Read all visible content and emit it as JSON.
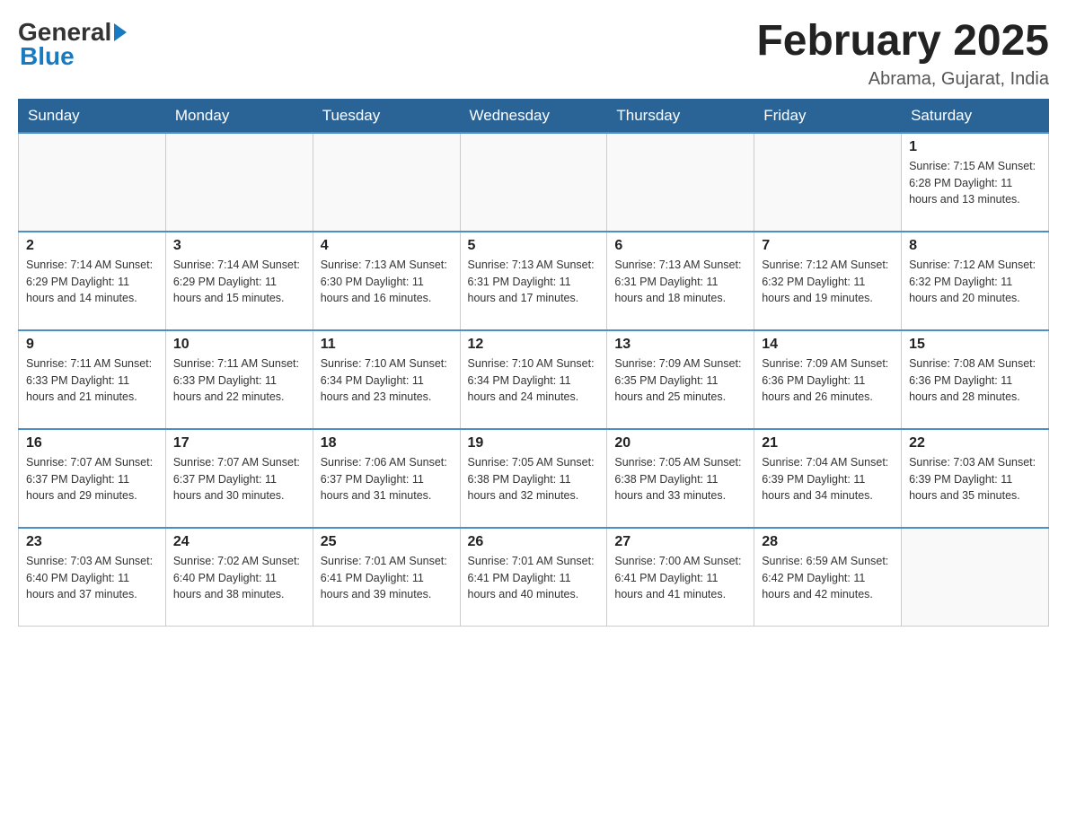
{
  "header": {
    "logo_general": "General",
    "logo_blue": "Blue",
    "month_title": "February 2025",
    "location": "Abrama, Gujarat, India"
  },
  "weekdays": [
    "Sunday",
    "Monday",
    "Tuesday",
    "Wednesday",
    "Thursday",
    "Friday",
    "Saturday"
  ],
  "weeks": [
    [
      {
        "day": "",
        "info": ""
      },
      {
        "day": "",
        "info": ""
      },
      {
        "day": "",
        "info": ""
      },
      {
        "day": "",
        "info": ""
      },
      {
        "day": "",
        "info": ""
      },
      {
        "day": "",
        "info": ""
      },
      {
        "day": "1",
        "info": "Sunrise: 7:15 AM\nSunset: 6:28 PM\nDaylight: 11 hours\nand 13 minutes."
      }
    ],
    [
      {
        "day": "2",
        "info": "Sunrise: 7:14 AM\nSunset: 6:29 PM\nDaylight: 11 hours\nand 14 minutes."
      },
      {
        "day": "3",
        "info": "Sunrise: 7:14 AM\nSunset: 6:29 PM\nDaylight: 11 hours\nand 15 minutes."
      },
      {
        "day": "4",
        "info": "Sunrise: 7:13 AM\nSunset: 6:30 PM\nDaylight: 11 hours\nand 16 minutes."
      },
      {
        "day": "5",
        "info": "Sunrise: 7:13 AM\nSunset: 6:31 PM\nDaylight: 11 hours\nand 17 minutes."
      },
      {
        "day": "6",
        "info": "Sunrise: 7:13 AM\nSunset: 6:31 PM\nDaylight: 11 hours\nand 18 minutes."
      },
      {
        "day": "7",
        "info": "Sunrise: 7:12 AM\nSunset: 6:32 PM\nDaylight: 11 hours\nand 19 minutes."
      },
      {
        "day": "8",
        "info": "Sunrise: 7:12 AM\nSunset: 6:32 PM\nDaylight: 11 hours\nand 20 minutes."
      }
    ],
    [
      {
        "day": "9",
        "info": "Sunrise: 7:11 AM\nSunset: 6:33 PM\nDaylight: 11 hours\nand 21 minutes."
      },
      {
        "day": "10",
        "info": "Sunrise: 7:11 AM\nSunset: 6:33 PM\nDaylight: 11 hours\nand 22 minutes."
      },
      {
        "day": "11",
        "info": "Sunrise: 7:10 AM\nSunset: 6:34 PM\nDaylight: 11 hours\nand 23 minutes."
      },
      {
        "day": "12",
        "info": "Sunrise: 7:10 AM\nSunset: 6:34 PM\nDaylight: 11 hours\nand 24 minutes."
      },
      {
        "day": "13",
        "info": "Sunrise: 7:09 AM\nSunset: 6:35 PM\nDaylight: 11 hours\nand 25 minutes."
      },
      {
        "day": "14",
        "info": "Sunrise: 7:09 AM\nSunset: 6:36 PM\nDaylight: 11 hours\nand 26 minutes."
      },
      {
        "day": "15",
        "info": "Sunrise: 7:08 AM\nSunset: 6:36 PM\nDaylight: 11 hours\nand 28 minutes."
      }
    ],
    [
      {
        "day": "16",
        "info": "Sunrise: 7:07 AM\nSunset: 6:37 PM\nDaylight: 11 hours\nand 29 minutes."
      },
      {
        "day": "17",
        "info": "Sunrise: 7:07 AM\nSunset: 6:37 PM\nDaylight: 11 hours\nand 30 minutes."
      },
      {
        "day": "18",
        "info": "Sunrise: 7:06 AM\nSunset: 6:37 PM\nDaylight: 11 hours\nand 31 minutes."
      },
      {
        "day": "19",
        "info": "Sunrise: 7:05 AM\nSunset: 6:38 PM\nDaylight: 11 hours\nand 32 minutes."
      },
      {
        "day": "20",
        "info": "Sunrise: 7:05 AM\nSunset: 6:38 PM\nDaylight: 11 hours\nand 33 minutes."
      },
      {
        "day": "21",
        "info": "Sunrise: 7:04 AM\nSunset: 6:39 PM\nDaylight: 11 hours\nand 34 minutes."
      },
      {
        "day": "22",
        "info": "Sunrise: 7:03 AM\nSunset: 6:39 PM\nDaylight: 11 hours\nand 35 minutes."
      }
    ],
    [
      {
        "day": "23",
        "info": "Sunrise: 7:03 AM\nSunset: 6:40 PM\nDaylight: 11 hours\nand 37 minutes."
      },
      {
        "day": "24",
        "info": "Sunrise: 7:02 AM\nSunset: 6:40 PM\nDaylight: 11 hours\nand 38 minutes."
      },
      {
        "day": "25",
        "info": "Sunrise: 7:01 AM\nSunset: 6:41 PM\nDaylight: 11 hours\nand 39 minutes."
      },
      {
        "day": "26",
        "info": "Sunrise: 7:01 AM\nSunset: 6:41 PM\nDaylight: 11 hours\nand 40 minutes."
      },
      {
        "day": "27",
        "info": "Sunrise: 7:00 AM\nSunset: 6:41 PM\nDaylight: 11 hours\nand 41 minutes."
      },
      {
        "day": "28",
        "info": "Sunrise: 6:59 AM\nSunset: 6:42 PM\nDaylight: 11 hours\nand 42 minutes."
      },
      {
        "day": "",
        "info": ""
      }
    ]
  ]
}
